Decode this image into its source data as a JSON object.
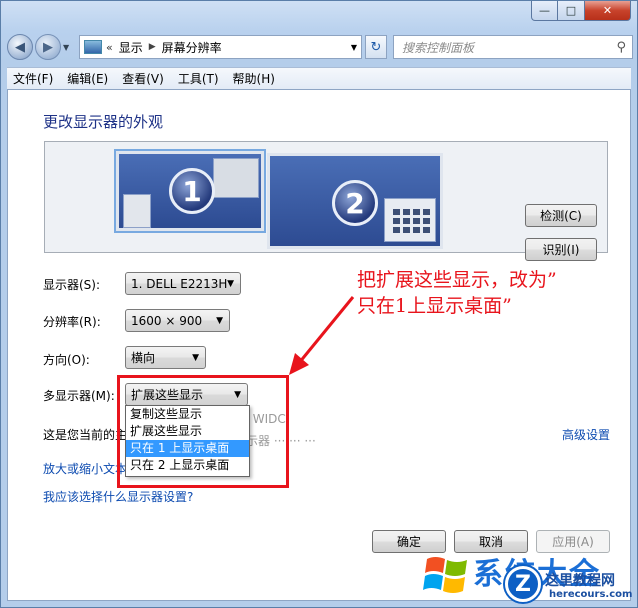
{
  "window": {
    "minimize_glyph": "—",
    "maximize_glyph": "□",
    "close_glyph": "✕"
  },
  "nav": {
    "address_arrows": "«",
    "breadcrumb": [
      "显示",
      "屏幕分辨率"
    ],
    "search_placeholder": "搜索控制面板"
  },
  "menu": {
    "items": [
      "文件(F)",
      "编辑(E)",
      "查看(V)",
      "工具(T)",
      "帮助(H)"
    ]
  },
  "main": {
    "heading": "更改显示器的外观",
    "monitor1_number": "1",
    "monitor2_number": "2",
    "detect_button": "检测(C)",
    "identify_button": "识别(I)",
    "display_label": "显示器(S):",
    "display_value": "1. DELL E2213H",
    "resolution_label": "分辨率(R):",
    "resolution_value": "1600 × 900",
    "orientation_label": "方向(O):",
    "orientation_value": "横向",
    "multi_label": "多显示器(M):",
    "multi_value": "扩展这些显示",
    "current_text": "这是您当前的主",
    "advanced_link": "高级设置",
    "enlarge_link": "放大或缩小文本",
    "choose_link": "我应该选择什么显示器设置?",
    "ghost_text_1": "r显 WIDC",
    "ghost_text_2": "显示器 ··· ··· ···"
  },
  "dropdown": {
    "options": [
      "复制这些显示",
      "扩展这些显示",
      "只在 1 上显示桌面",
      "只在 2 上显示桌面"
    ],
    "selected_index": 2
  },
  "buttons": {
    "ok": "确定",
    "cancel": "取消",
    "apply": "应用(A)"
  },
  "annotation": {
    "line1": "把扩展这些显示，改为”",
    "line2": "只在1上显示桌面”",
    "color": "#e8141c"
  },
  "watermark": {
    "brand_partial": "系统大全",
    "circle_letter": "Z",
    "site_name": "这里教程网",
    "site_url": "herecours.com"
  },
  "icons": [
    "back-arrow-icon",
    "forward-arrow-icon",
    "control-panel-icon",
    "refresh-icon",
    "search-icon",
    "dropdown-arrow-icon",
    "windows-logo-icon"
  ]
}
